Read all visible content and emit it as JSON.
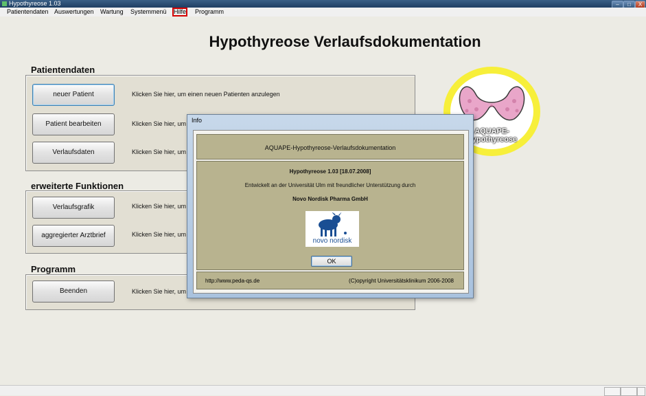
{
  "window": {
    "title": "Hypothyreose 1.03",
    "controls": [
      "–",
      "□",
      "X"
    ]
  },
  "menu": [
    {
      "label": "Patientendaten",
      "highlighted": false
    },
    {
      "label": "Auswertungen",
      "highlighted": false
    },
    {
      "label": "Wartung",
      "highlighted": false
    },
    {
      "label": "Systemmenü",
      "highlighted": false
    },
    {
      "label": "Hilfe",
      "highlighted": true
    },
    {
      "label": "Programm",
      "highlighted": false
    }
  ],
  "app_title": "Hypothyreose Verlaufsdokumentation",
  "sections": {
    "patientendaten": {
      "label": "Patientendaten",
      "rows": [
        {
          "button": "neuer Patient",
          "hint": "Klicken Sie hier, um einen neuen Patienten anzulegen"
        },
        {
          "button": "Patient bearbeiten",
          "hint": "Klicken Sie hier, um"
        },
        {
          "button": "Verlaufsdaten",
          "hint": "Klicken Sie hier, um"
        }
      ]
    },
    "erweitert": {
      "label": "erweiterte Funktionen",
      "rows": [
        {
          "button": "Verlaufsgrafik",
          "hint": "Klicken Sie hier, um"
        },
        {
          "button": "aggregierter Arztbrief",
          "hint": "Klicken Sie hier, um"
        }
      ]
    },
    "programm": {
      "label": "Programm",
      "rows": [
        {
          "button": "Beenden",
          "hint": "Klicken Sie hier, um"
        }
      ]
    }
  },
  "logo": {
    "text_line1": "AQUAPE-",
    "text_line2": "Hypothyreose",
    "ring_color": "#f7ef3a",
    "gland_color": "#e9a6c9"
  },
  "dialog": {
    "title": "Info",
    "header": "AQUAPE-Hypothyreose-Verlaufsdokumentation",
    "version": "Hypothyreose 1.03 [18.07.2008]",
    "developed": "Entwickelt an der Universität Ulm mit freundlicher Unterstützung durch",
    "sponsor": "Novo Nordisk Pharma GmbH",
    "sponsor_logo_text": "novo nordisk",
    "ok_label": "OK",
    "url": "http://www.peda-qs.de",
    "copyright": "(C)opyright Universitätsklinikum 2006-2008"
  },
  "colors": {
    "panel": "#e2dfd3",
    "dialog_panel": "#b8b38f",
    "highlight": "#d40000"
  }
}
